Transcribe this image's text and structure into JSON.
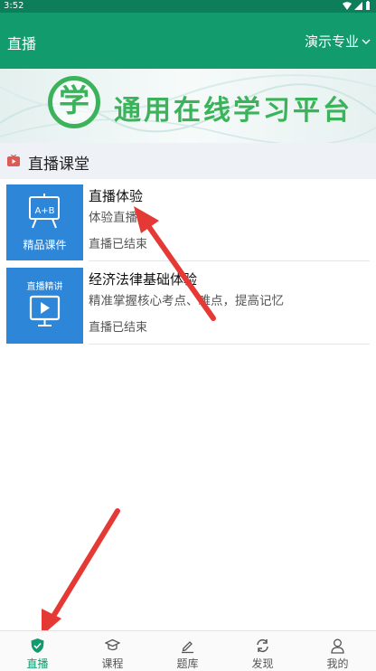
{
  "status_bar": {
    "time": "3:52"
  },
  "app_bar": {
    "title": "直播",
    "major": "演示专业"
  },
  "banner": {
    "logo_char": "学",
    "slogan": "通用在线学习平台"
  },
  "section": {
    "title": "直播课堂"
  },
  "courses": [
    {
      "thumb_caption": "精品课件",
      "thumb_board": "A+B",
      "title": "直播体验",
      "desc": "体验直播",
      "status": "直播已结束"
    },
    {
      "thumb_caption": "直播精讲",
      "title": "经济法律基础体验",
      "desc": "精准掌握核心考点、难点，提高记忆",
      "status": "直播已结束"
    }
  ],
  "tabs": [
    {
      "label": "直播",
      "icon": "shield-check-icon",
      "active": true
    },
    {
      "label": "课程",
      "icon": "graduation-cap-icon",
      "active": false
    },
    {
      "label": "题库",
      "icon": "pencil-icon",
      "active": false
    },
    {
      "label": "发现",
      "icon": "refresh-icon",
      "active": false
    },
    {
      "label": "我的",
      "icon": "person-icon",
      "active": false
    }
  ],
  "colors": {
    "primary": "#129b6d",
    "status_bar": "#0d7d5a",
    "section_bg": "#eef2f7",
    "thumb_blue": "#2e86d8",
    "arrow_red": "#e53935",
    "logo_green": "#3bb35b"
  }
}
